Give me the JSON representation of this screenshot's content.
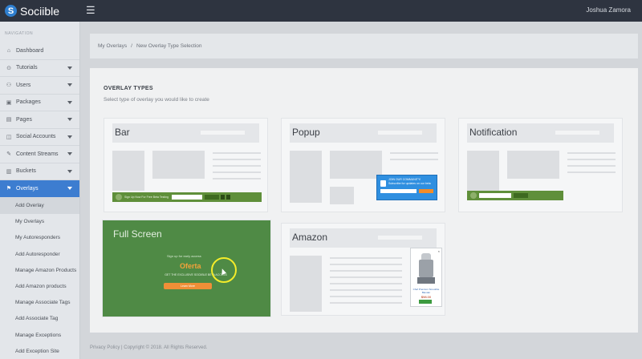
{
  "app": {
    "name": "Sociible",
    "logo_letter": "S"
  },
  "topbar": {
    "menu_icon": "☰",
    "user_name": "Joshua Zamora"
  },
  "sidebar": {
    "header": "NAVIGATION",
    "items": [
      {
        "label": "Dashboard",
        "icon": "⌂",
        "has_arrow": false
      },
      {
        "label": "Tutorials",
        "icon": "⊙",
        "has_arrow": true
      },
      {
        "label": "Users",
        "icon": "⚇",
        "has_arrow": true
      },
      {
        "label": "Packages",
        "icon": "▣",
        "has_arrow": true
      },
      {
        "label": "Pages",
        "icon": "▤",
        "has_arrow": true
      },
      {
        "label": "Social Accounts",
        "icon": "◫",
        "has_arrow": true
      },
      {
        "label": "Content Streams",
        "icon": "✎",
        "has_arrow": true
      },
      {
        "label": "Buckets",
        "icon": "▥",
        "has_arrow": true
      },
      {
        "label": "Overlays",
        "icon": "⚑",
        "has_arrow": true
      }
    ],
    "sub_items": [
      "Add Overlay",
      "My Overlays",
      "My Autoresponders",
      "Add Autoresponder",
      "Manage Amazon Products",
      "Add Amazon products",
      "Manage Associate Tags",
      "Add Associate Tag",
      "Manage Exceptions",
      "Add Exception Site"
    ]
  },
  "breadcrumb": {
    "parent": "My Overlays",
    "separator": "/",
    "current": "New Overlay Type Selection"
  },
  "panel": {
    "title": "OVERLAY TYPES",
    "subtitle": "Select type of overlay you would like to create",
    "cards": {
      "bar": "Bar",
      "popup": "Popup",
      "notification": "Notification",
      "full_screen": "Full Screen",
      "amazon": "Amazon"
    },
    "bar_preview": {
      "text": "Sign Up Now For Free Beta Testing"
    },
    "popup_preview": {
      "line1": "JOIN OUR COMMUNITY!",
      "line2": "Subscribe for updates on our beta"
    },
    "full_preview": {
      "small": "Sign up for early access",
      "headline": "Oferta",
      "desc": "GET THE EXCLUSIVE SOCIIBLE BETA ACCESS",
      "button": "Learn More"
    },
    "amazon_preview": {
      "name": "Chef Premium Smoothie Blender",
      "price": "$98.00"
    }
  },
  "footer": {
    "text": "Privacy Policy | Copyright © 2018. All Rights Reserved."
  },
  "colors": {
    "accent": "#3d7dd0",
    "topbar": "#2e3440",
    "full_screen_bg": "#4f8a45",
    "highlight_circle": "#f4ec2a"
  }
}
